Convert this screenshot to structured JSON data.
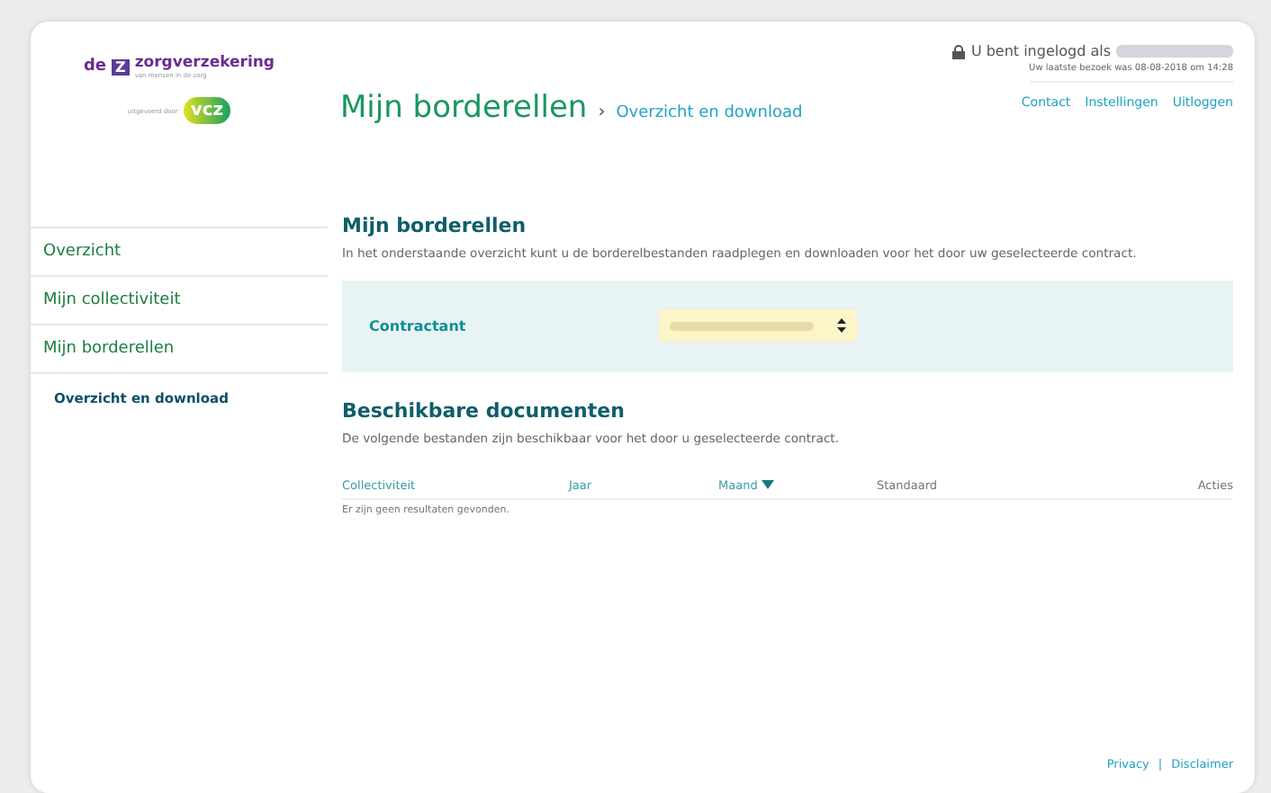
{
  "logo": {
    "prefix": "de",
    "mark": "Z",
    "name": "zorgverzekering",
    "tagline": "van mensen in de zorg",
    "partner_label": "uitgevoerd door",
    "partner": "vcz"
  },
  "header": {
    "title": "Mijn borderellen",
    "separator": "›",
    "breadcrumb": "Overzicht en download",
    "login_text": "U bent ingelogd als",
    "last_visit": "Uw laatste bezoek was 08-08-2018 om 14:28",
    "links": [
      "Contact",
      "Instellingen",
      "Uitloggen"
    ]
  },
  "sidebar": {
    "items": [
      {
        "label": "Overzicht",
        "selected": false
      },
      {
        "label": "Mijn collectiviteit",
        "selected": false
      },
      {
        "label": "Mijn borderellen",
        "selected": false,
        "children": [
          {
            "label": "Overzicht en download",
            "selected": true
          }
        ]
      }
    ]
  },
  "intro": {
    "title": "Mijn borderellen",
    "text": "In het onderstaande overzicht kunt u de borderelbestanden raadplegen en downloaden voor het door uw geselecteerde contract."
  },
  "filter": {
    "label": "Contractant"
  },
  "documents": {
    "title": "Beschikbare documenten",
    "text": "De volgende bestanden zijn beschikbaar voor het door u geselecteerde contract.",
    "columns": [
      {
        "label": "Collectiviteit",
        "sorted": false
      },
      {
        "label": "Jaar",
        "sorted": false
      },
      {
        "label": "Maand",
        "sorted": true
      },
      {
        "label": "Standaard",
        "sorted": false
      },
      {
        "label": "Acties",
        "sorted": false
      }
    ],
    "empty": "Er zijn geen resultaten gevonden."
  },
  "footer": {
    "links": [
      "Privacy",
      "Disclaimer"
    ],
    "separator": "|"
  }
}
